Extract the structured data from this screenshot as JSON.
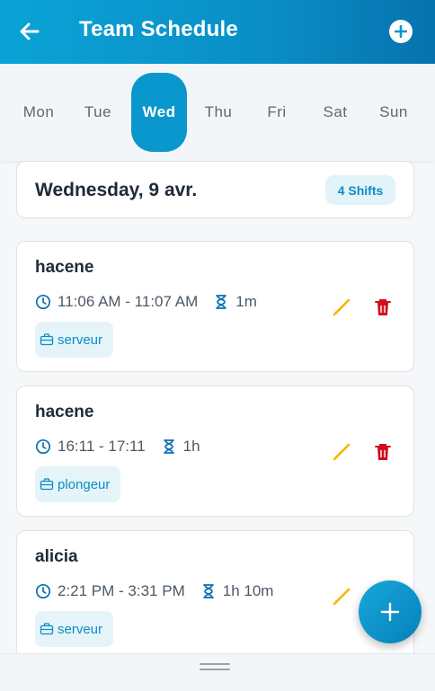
{
  "header": {
    "title": "Team Schedule",
    "back_icon": "arrow-left-icon",
    "add_icon": "plus-circle-icon"
  },
  "days": [
    {
      "label": "Mon",
      "active": false
    },
    {
      "label": "Tue",
      "active": false
    },
    {
      "label": "Wed",
      "active": true
    },
    {
      "label": "Thu",
      "active": false
    },
    {
      "label": "Fri",
      "active": false
    },
    {
      "label": "Sat",
      "active": false
    },
    {
      "label": "Sun",
      "active": false
    }
  ],
  "summary": {
    "date": "Wednesday, 9 avr.",
    "shift_count": "4 Shifts"
  },
  "shifts": [
    {
      "name": "hacene",
      "time": "11:06 AM - 11:07 AM",
      "duration": "1m",
      "role": "serveur",
      "deletable": true
    },
    {
      "name": "hacene",
      "time": "16:11 - 17:11",
      "duration": "1h",
      "role": "plongeur",
      "deletable": true
    },
    {
      "name": "alicia",
      "time": "2:21 PM - 3:31 PM",
      "duration": "1h 10m",
      "role": "serveur",
      "deletable": false
    }
  ],
  "colors": {
    "primary": "#0a97cd",
    "edit": "#f2b705",
    "delete": "#d0101e",
    "chip_bg": "#e5f4f9"
  },
  "fab_icon": "plus-icon"
}
